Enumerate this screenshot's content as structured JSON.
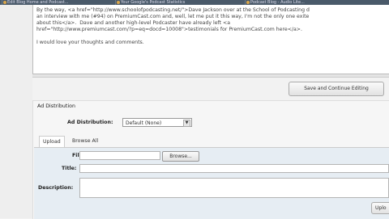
{
  "browser": {
    "tabs": [
      "Edit Blog Home and Podcast...",
      "Your Google's Podcast Statistics",
      "Podcast Blog - Audio Lite..."
    ]
  },
  "editor": {
    "lines": [
      "By the way, <a href=\"http://www.schoolofpodcasting.net/\">Dave Jackson over at the School of Podcasting d",
      "an interview with me (#94) on PremiumCast.com and, well, let me put it this way, I'm not the only one exite",
      "about this</a>.  Dave and another high-level Podcaster have already left <a",
      "href=\"http://www.premiumcast.com/?p=eq=docd=10008\">testimonials for PremiumCast.com here</a>.",
      "",
      "I would love your thoughts and comments."
    ]
  },
  "toolbar": {
    "save_label": "Save and Continue Editing"
  },
  "ad": {
    "section_title": "Ad Distribution",
    "field_label": "Ad Distribution:",
    "selected": "Default (None)"
  },
  "upload": {
    "tabs": [
      "Upload",
      "Browse All"
    ],
    "file_label": "File:",
    "browse_label": "Browse...",
    "title_label": "Title:",
    "description_label": "Description:",
    "upload_button": "Uplo"
  }
}
